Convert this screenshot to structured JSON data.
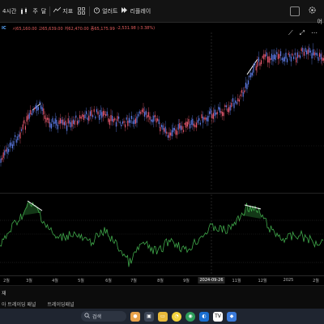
{
  "toolbar": {
    "timeframe": "4시간",
    "chart_type_icon": "candles-icon",
    "compare": "주",
    "layout_label": "달",
    "indicators": "지표",
    "alert": "얼러트",
    "replay": "리플레이"
  },
  "side_label": "어",
  "legend": {
    "symbol": "IC",
    "open": "시65,160.00",
    "high": "고65,639.00",
    "low": "저62,470.00",
    "close": "종65,175.99",
    "change": "-2,531.98 (-3.38%)"
  },
  "time_axis": {
    "labels": [
      "2월",
      "3월",
      "4월",
      "5월",
      "6월",
      "7월",
      "8월",
      "9월",
      "10월",
      "11월",
      "12월",
      "2025",
      "2월"
    ],
    "cursor_date": "2024-09-26"
  },
  "status": {
    "text": "재"
  },
  "tabs": [
    "아 트레이딩 패널",
    "트레이딩패널"
  ],
  "taskbar": {
    "search_placeholder": "검색"
  },
  "colors": {
    "up": "#e0556b",
    "down": "#5a78e0",
    "oscillator": "#3fa84a",
    "trendline": "#ffffff",
    "background": "#000000"
  }
}
